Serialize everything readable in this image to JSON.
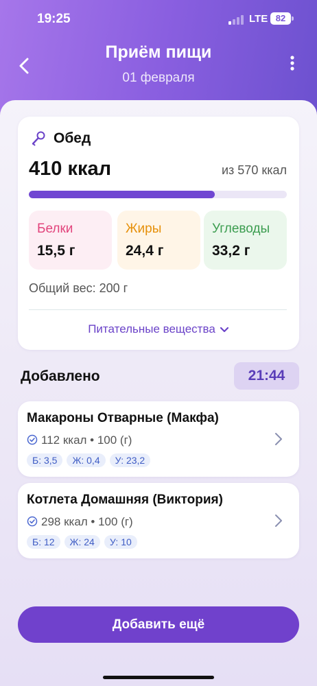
{
  "status_bar": {
    "time": "19:25",
    "network": "LTE",
    "battery": "82"
  },
  "header": {
    "title": "Приём пищи",
    "date": "01 февраля",
    "back_icon": "chevron-left-icon",
    "menu_icon": "more-vertical-icon"
  },
  "meal": {
    "icon": "meal-icon",
    "name": "Обед",
    "kcal_eaten": "410 ккал",
    "kcal_goal": "из 570 ккал",
    "progress_fraction": 0.72,
    "macros": {
      "protein": {
        "label": "Белки",
        "value": "15,5 г"
      },
      "fat": {
        "label": "Жиры",
        "value": "24,4 г"
      },
      "carbs": {
        "label": "Углеводы",
        "value": "33,2 г"
      }
    },
    "total_weight": "Общий вес: 200 г",
    "nutrients_label": "Питательные вещества"
  },
  "added": {
    "label": "Добавлено",
    "time": "21:44",
    "items": [
      {
        "name": "Макароны Отварные (Макфа)",
        "info": "112 ккал • 100 (г)",
        "chips": [
          "Б: 3,5",
          "Ж: 0,4",
          "У: 23,2"
        ]
      },
      {
        "name": "Котлета Домашняя (Виктория)",
        "info": "298 ккал • 100 (г)",
        "chips": [
          "Б: 12",
          "Ж: 24",
          "У: 10"
        ]
      }
    ]
  },
  "add_more_label": "Добавить ещё",
  "colors": {
    "accent": "#7041cc",
    "protein": "#e2447c",
    "fat": "#e6900a",
    "carbs": "#3c9d50"
  }
}
